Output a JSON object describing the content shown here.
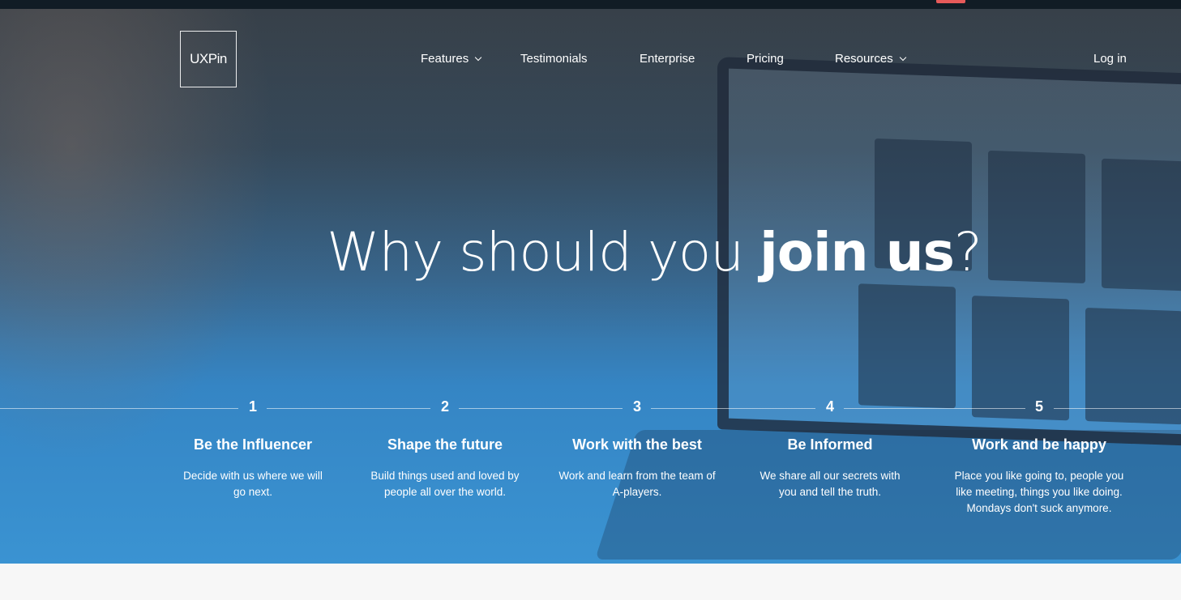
{
  "brand": {
    "logo_text": "UXPin"
  },
  "nav": {
    "items": [
      {
        "label": "Features",
        "has_dropdown": true
      },
      {
        "label": "Testimonials",
        "has_dropdown": false
      },
      {
        "label": "Enterprise",
        "has_dropdown": false
      },
      {
        "label": "Pricing",
        "has_dropdown": false
      },
      {
        "label": "Resources",
        "has_dropdown": true
      }
    ],
    "login_label": "Log in"
  },
  "hero": {
    "headline_start": "Why should you ",
    "headline_strong": "join us",
    "headline_end": "?"
  },
  "steps": [
    {
      "number": "1",
      "title": "Be the Influencer",
      "description": "Decide with us where we will go next."
    },
    {
      "number": "2",
      "title": "Shape the future",
      "description": "Build things used and loved by people all over the world."
    },
    {
      "number": "3",
      "title": "Work with the best",
      "description": "Work and learn from the team of A-players."
    },
    {
      "number": "4",
      "title": "Be Informed",
      "description": "We share all our secrets with you and tell the truth."
    },
    {
      "number": "5",
      "title": "Work and be happy",
      "description": "Place you like going to, people you like meeting, things you like doing. Mondays don't suck anymore."
    }
  ],
  "colors": {
    "hero_blue": "#3a93d2",
    "notification": "#e65a5a",
    "topbar": "#111c25"
  }
}
